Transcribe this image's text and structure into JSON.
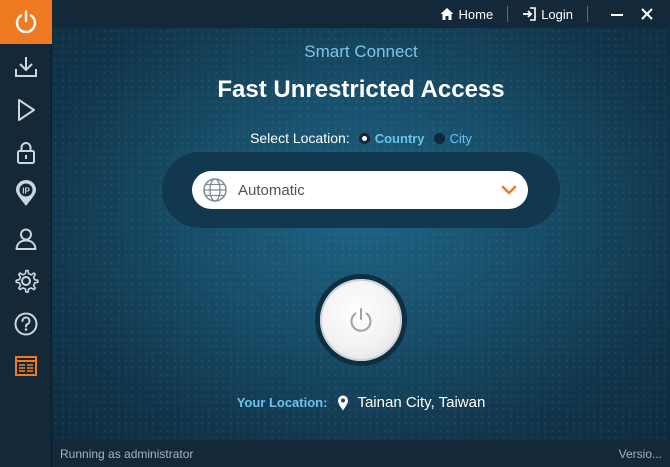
{
  "window": {
    "home_label": "Home",
    "login_label": "Login"
  },
  "sidebar": {
    "items": [
      {
        "icon": "power-icon",
        "active": true
      },
      {
        "icon": "download-icon"
      },
      {
        "icon": "play-icon"
      },
      {
        "icon": "lock-icon"
      },
      {
        "icon": "ip-location-icon"
      },
      {
        "icon": "user-icon"
      },
      {
        "icon": "gear-icon"
      },
      {
        "icon": "help-icon"
      },
      {
        "icon": "news-icon"
      }
    ]
  },
  "main": {
    "subtitle": "Smart Connect",
    "headline": "Fast Unrestricted Access",
    "select_location_label": "Select Location:",
    "radio_country": "Country",
    "radio_city": "City",
    "selected_mode": "Country",
    "dropdown_value": "Automatic",
    "your_location_label": "Your Location:",
    "your_location_value": "Tainan City, Taiwan"
  },
  "status": {
    "left": "Running as administrator",
    "right": "Versio..."
  },
  "colors": {
    "accent": "#f07a22",
    "link": "#6ac3ee",
    "sidebar_bg": "#142838"
  }
}
